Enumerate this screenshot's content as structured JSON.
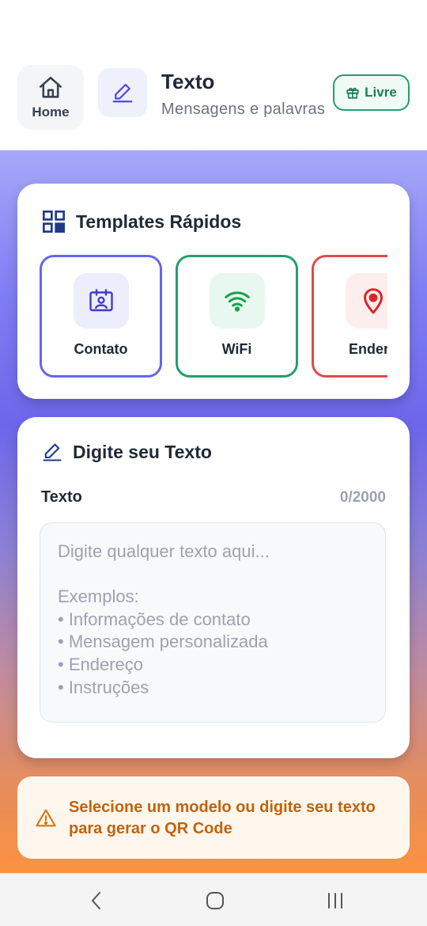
{
  "header": {
    "home_label": "Home",
    "title": "Texto",
    "subtitle": "Mensagens e palavras",
    "badge": "Livre"
  },
  "templates": {
    "title": "Templates Rápidos",
    "items": [
      {
        "label": "Contato",
        "icon": "contact-card-icon",
        "color": "#6366f1"
      },
      {
        "label": "WiFi",
        "icon": "wifi-icon",
        "color": "#22a06b"
      },
      {
        "label": "Endere",
        "icon": "location-pin-icon",
        "color": "#e34848"
      }
    ]
  },
  "text_section": {
    "title": "Digite seu Texto",
    "field_label": "Texto",
    "counter": "0/2000",
    "placeholder": "Digite qualquer texto aqui...\n\nExemplos:\n• Informações de contato\n• Mensagem personalizada\n• Endereço\n• Instruções"
  },
  "warning": {
    "text": "Selecione um modelo ou digite seu texto para gerar o QR Code",
    "icon": "warning-triangle-icon"
  },
  "navbar": {
    "back_icon": "back-chevron-icon",
    "home_icon": "home-circle-icon",
    "recent_icon": "recent-apps-icon"
  },
  "colors": {
    "accent": "#6366f1",
    "success": "#22a06b",
    "danger": "#e34848",
    "warning": "#c2620c"
  }
}
